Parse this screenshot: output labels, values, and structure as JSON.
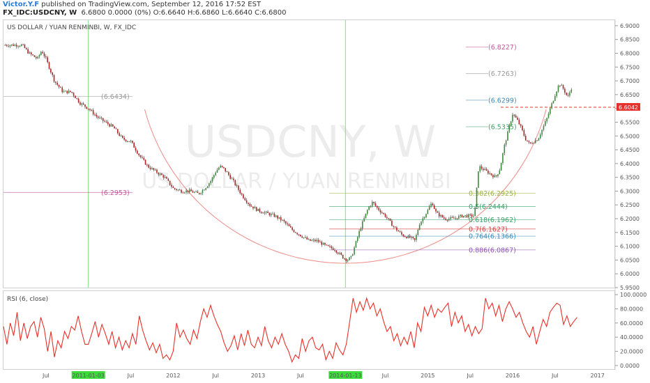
{
  "header": {
    "author": "Victor.Y.F",
    "published": " published on TradingView.com, September 12, 2016 17:52 EST",
    "symbol": "FX_IDC:USDCNY, W",
    "ohlc": "6.6800 0.0000 (0%) O:6.6640 H:6.6860 L:6.6640 C:6.6800"
  },
  "main_panel": {
    "title": "US DOLLAR / YUAN RENMINBI, W, FX_IDC",
    "watermark_symbol": "USDCNY, W",
    "watermark_name": "US DOLLAR / YUAN RENMINBI"
  },
  "rsi_panel": {
    "title": "RSI (6, close)"
  },
  "price_badge": {
    "value": "6.6042",
    "color": "#e8302a"
  },
  "colors": {
    "candle_up": "#3b8a3b",
    "candle_down": "#b22222",
    "rsi": "#e8302a",
    "arc": "#e8302a"
  },
  "chart_data": [
    {
      "type": "candlestick",
      "ylim": [
        5.95,
        6.92
      ],
      "yticks": [
        "6.9000",
        "6.8500",
        "6.8000",
        "6.7500",
        "6.7000",
        "6.6500",
        "6.6000",
        "6.5500",
        "6.5000",
        "6.4500",
        "6.4000",
        "6.3500",
        "6.3000",
        "6.2500",
        "6.2000",
        "6.1500",
        "6.1000",
        "6.0500",
        "6.0000",
        "5.9500"
      ],
      "ytick_values": [
        6.9,
        6.85,
        6.8,
        6.75,
        6.7,
        6.65,
        6.6,
        6.55,
        6.5,
        6.45,
        6.4,
        6.35,
        6.3,
        6.25,
        6.2,
        6.15,
        6.1,
        6.05,
        6.0,
        5.95
      ],
      "xticks": [
        "Jul",
        "2011-01-03",
        "Jul",
        "2012",
        "Jul",
        "2013",
        "Jul",
        "2014-01-13",
        "Jul",
        "2015",
        "Jul",
        "2016",
        "Jul",
        "2017"
      ],
      "xtick_years": [
        2010.5,
        2011.0,
        2011.5,
        2012.0,
        2012.5,
        2013.0,
        2013.5,
        2014.03,
        2014.5,
        2015.0,
        2015.5,
        2016.0,
        2016.5,
        2017.0
      ],
      "highlighted_xticks": [
        "2011-01-03",
        "2014-01-13"
      ],
      "price_path": [
        [
          2010.0,
          6.83
        ],
        [
          2010.15,
          6.83
        ],
        [
          2010.22,
          6.83
        ],
        [
          2010.3,
          6.8
        ],
        [
          2010.4,
          6.78
        ],
        [
          2010.45,
          6.81
        ],
        [
          2010.5,
          6.78
        ],
        [
          2010.6,
          6.7
        ],
        [
          2010.7,
          6.66
        ],
        [
          2010.8,
          6.66
        ],
        [
          2010.9,
          6.62
        ],
        [
          2011.0,
          6.6
        ],
        [
          2011.1,
          6.57
        ],
        [
          2011.2,
          6.55
        ],
        [
          2011.3,
          6.53
        ],
        [
          2011.4,
          6.49
        ],
        [
          2011.5,
          6.48
        ],
        [
          2011.6,
          6.43
        ],
        [
          2011.7,
          6.39
        ],
        [
          2011.8,
          6.37
        ],
        [
          2011.9,
          6.35
        ],
        [
          2012.0,
          6.31
        ],
        [
          2012.1,
          6.3
        ],
        [
          2012.2,
          6.3
        ],
        [
          2012.3,
          6.29
        ],
        [
          2012.4,
          6.32
        ],
        [
          2012.45,
          6.34
        ],
        [
          2012.5,
          6.37
        ],
        [
          2012.55,
          6.39
        ],
        [
          2012.6,
          6.38
        ],
        [
          2012.7,
          6.34
        ],
        [
          2012.8,
          6.29
        ],
        [
          2012.9,
          6.25
        ],
        [
          2013.0,
          6.23
        ],
        [
          2013.1,
          6.22
        ],
        [
          2013.2,
          6.21
        ],
        [
          2013.3,
          6.19
        ],
        [
          2013.4,
          6.16
        ],
        [
          2013.5,
          6.14
        ],
        [
          2013.6,
          6.12
        ],
        [
          2013.7,
          6.12
        ],
        [
          2013.8,
          6.1
        ],
        [
          2013.9,
          6.09
        ],
        [
          2014.0,
          6.06
        ],
        [
          2014.05,
          6.05
        ],
        [
          2014.1,
          6.06
        ],
        [
          2014.2,
          6.16
        ],
        [
          2014.3,
          6.24
        ],
        [
          2014.35,
          6.26
        ],
        [
          2014.4,
          6.24
        ],
        [
          2014.5,
          6.21
        ],
        [
          2014.6,
          6.17
        ],
        [
          2014.7,
          6.14
        ],
        [
          2014.8,
          6.13
        ],
        [
          2014.85,
          6.12
        ],
        [
          2014.9,
          6.18
        ],
        [
          2015.0,
          6.23
        ],
        [
          2015.05,
          6.26
        ],
        [
          2015.1,
          6.22
        ],
        [
          2015.2,
          6.2
        ],
        [
          2015.3,
          6.2
        ],
        [
          2015.4,
          6.21
        ],
        [
          2015.5,
          6.21
        ],
        [
          2015.55,
          6.21
        ],
        [
          2015.6,
          6.39
        ],
        [
          2015.7,
          6.37
        ],
        [
          2015.8,
          6.35
        ],
        [
          2015.85,
          6.38
        ],
        [
          2015.9,
          6.46
        ],
        [
          2016.0,
          6.58
        ],
        [
          2016.05,
          6.56
        ],
        [
          2016.1,
          6.53
        ],
        [
          2016.15,
          6.49
        ],
        [
          2016.2,
          6.47
        ],
        [
          2016.3,
          6.49
        ],
        [
          2016.4,
          6.56
        ],
        [
          2016.5,
          6.65
        ],
        [
          2016.55,
          6.69
        ],
        [
          2016.6,
          6.67
        ],
        [
          2016.65,
          6.64
        ],
        [
          2016.7,
          6.68
        ]
      ],
      "levels": [
        {
          "label": "(6.6434)",
          "value": 6.6434
        },
        {
          "label": "(6.2953)",
          "value": 6.2953
        },
        {
          "label": "(6.8227)",
          "value": 6.8227
        },
        {
          "label": "(6.7263)",
          "value": 6.7263
        },
        {
          "label": "(6.6299)",
          "value": 6.6299
        },
        {
          "label": "(6.5335)",
          "value": 6.5335
        },
        {
          "label": "0.382(6.2925)",
          "value": 6.2925
        },
        {
          "label": "0.5(6.2444)",
          "value": 6.2444
        },
        {
          "label": "0.618(6.1962)",
          "value": 6.1962
        },
        {
          "label": "0.7(6.1627)",
          "value": 6.1627
        },
        {
          "label": "0.764(6.1366)",
          "value": 6.1366
        },
        {
          "label": "0.886(6.0867)",
          "value": 6.0867
        }
      ],
      "last_price": 6.6042
    },
    {
      "type": "line",
      "name": "RSI (6, close)",
      "ylim": [
        -5,
        105
      ],
      "yticks": [
        "100.0000",
        "80.0000",
        "60.0000",
        "40.0000",
        "20.0000",
        "0.0000"
      ],
      "ytick_values": [
        100,
        80,
        60,
        40,
        20,
        0
      ],
      "rsi_path": [
        [
          2010.0,
          55
        ],
        [
          2010.04,
          30
        ],
        [
          2010.08,
          60
        ],
        [
          2010.12,
          42
        ],
        [
          2010.16,
          75
        ],
        [
          2010.2,
          35
        ],
        [
          2010.24,
          60
        ],
        [
          2010.28,
          38
        ],
        [
          2010.32,
          55
        ],
        [
          2010.36,
          62
        ],
        [
          2010.4,
          40
        ],
        [
          2010.44,
          68
        ],
        [
          2010.48,
          52
        ],
        [
          2010.52,
          20
        ],
        [
          2010.56,
          48
        ],
        [
          2010.6,
          12
        ],
        [
          2010.64,
          35
        ],
        [
          2010.68,
          25
        ],
        [
          2010.72,
          48
        ],
        [
          2010.76,
          38
        ],
        [
          2010.8,
          55
        ],
        [
          2010.84,
          50
        ],
        [
          2010.88,
          70
        ],
        [
          2010.92,
          48
        ],
        [
          2010.96,
          30
        ],
        [
          2011.0,
          30
        ],
        [
          2011.04,
          45
        ],
        [
          2011.08,
          62
        ],
        [
          2011.12,
          40
        ],
        [
          2011.16,
          58
        ],
        [
          2011.2,
          45
        ],
        [
          2011.24,
          30
        ],
        [
          2011.28,
          48
        ],
        [
          2011.32,
          25
        ],
        [
          2011.36,
          40
        ],
        [
          2011.4,
          22
        ],
        [
          2011.44,
          35
        ],
        [
          2011.48,
          25
        ],
        [
          2011.52,
          45
        ],
        [
          2011.56,
          30
        ],
        [
          2011.6,
          70
        ],
        [
          2011.64,
          50
        ],
        [
          2011.68,
          35
        ],
        [
          2011.72,
          22
        ],
        [
          2011.76,
          32
        ],
        [
          2011.8,
          18
        ],
        [
          2011.84,
          30
        ],
        [
          2011.88,
          10
        ],
        [
          2011.92,
          15
        ],
        [
          2011.96,
          8
        ],
        [
          2012.0,
          20
        ],
        [
          2012.04,
          60
        ],
        [
          2012.08,
          40
        ],
        [
          2012.12,
          50
        ],
        [
          2012.16,
          38
        ],
        [
          2012.2,
          30
        ],
        [
          2012.24,
          50
        ],
        [
          2012.28,
          38
        ],
        [
          2012.32,
          62
        ],
        [
          2012.36,
          80
        ],
        [
          2012.4,
          68
        ],
        [
          2012.44,
          85
        ],
        [
          2012.48,
          70
        ],
        [
          2012.52,
          58
        ],
        [
          2012.56,
          48
        ],
        [
          2012.6,
          32
        ],
        [
          2012.64,
          20
        ],
        [
          2012.68,
          28
        ],
        [
          2012.72,
          42
        ],
        [
          2012.76,
          22
        ],
        [
          2012.8,
          45
        ],
        [
          2012.84,
          28
        ],
        [
          2012.88,
          50
        ],
        [
          2012.92,
          30
        ],
        [
          2012.96,
          25
        ],
        [
          2013.0,
          40
        ],
        [
          2013.04,
          28
        ],
        [
          2013.08,
          55
        ],
        [
          2013.12,
          35
        ],
        [
          2013.16,
          25
        ],
        [
          2013.2,
          40
        ],
        [
          2013.24,
          30
        ],
        [
          2013.28,
          45
        ],
        [
          2013.32,
          30
        ],
        [
          2013.36,
          20
        ],
        [
          2013.4,
          5
        ],
        [
          2013.44,
          15
        ],
        [
          2013.48,
          10
        ],
        [
          2013.52,
          38
        ],
        [
          2013.56,
          20
        ],
        [
          2013.6,
          35
        ],
        [
          2013.64,
          40
        ],
        [
          2013.68,
          25
        ],
        [
          2013.72,
          22
        ],
        [
          2013.76,
          30
        ],
        [
          2013.8,
          8
        ],
        [
          2013.84,
          20
        ],
        [
          2013.88,
          10
        ],
        [
          2013.92,
          32
        ],
        [
          2013.96,
          22
        ],
        [
          2014.0,
          15
        ],
        [
          2014.04,
          30
        ],
        [
          2014.08,
          62
        ],
        [
          2014.12,
          95
        ],
        [
          2014.16,
          75
        ],
        [
          2014.2,
          90
        ],
        [
          2014.24,
          78
        ],
        [
          2014.28,
          95
        ],
        [
          2014.32,
          80
        ],
        [
          2014.36,
          88
        ],
        [
          2014.4,
          70
        ],
        [
          2014.44,
          80
        ],
        [
          2014.48,
          62
        ],
        [
          2014.52,
          48
        ],
        [
          2014.56,
          55
        ],
        [
          2014.6,
          35
        ],
        [
          2014.64,
          45
        ],
        [
          2014.68,
          28
        ],
        [
          2014.72,
          40
        ],
        [
          2014.76,
          30
        ],
        [
          2014.8,
          48
        ],
        [
          2014.84,
          25
        ],
        [
          2014.88,
          60
        ],
        [
          2014.92,
          48
        ],
        [
          2014.96,
          82
        ],
        [
          2015.0,
          70
        ],
        [
          2015.04,
          85
        ],
        [
          2015.08,
          68
        ],
        [
          2015.12,
          80
        ],
        [
          2015.16,
          75
        ],
        [
          2015.2,
          82
        ],
        [
          2015.24,
          88
        ],
        [
          2015.28,
          55
        ],
        [
          2015.32,
          75
        ],
        [
          2015.36,
          60
        ],
        [
          2015.4,
          70
        ],
        [
          2015.44,
          48
        ],
        [
          2015.48,
          58
        ],
        [
          2015.52,
          42
        ],
        [
          2015.56,
          55
        ],
        [
          2015.6,
          45
        ],
        [
          2015.64,
          52
        ],
        [
          2015.68,
          95
        ],
        [
          2015.72,
          80
        ],
        [
          2015.76,
          88
        ],
        [
          2015.8,
          70
        ],
        [
          2015.84,
          85
        ],
        [
          2015.88,
          62
        ],
        [
          2015.92,
          80
        ],
        [
          2015.96,
          90
        ],
        [
          2016.0,
          80
        ],
        [
          2016.04,
          68
        ],
        [
          2016.08,
          75
        ],
        [
          2016.12,
          60
        ],
        [
          2016.16,
          48
        ],
        [
          2016.2,
          40
        ],
        [
          2016.24,
          55
        ],
        [
          2016.28,
          30
        ],
        [
          2016.32,
          48
        ],
        [
          2016.36,
          65
        ],
        [
          2016.4,
          55
        ],
        [
          2016.44,
          75
        ],
        [
          2016.48,
          82
        ],
        [
          2016.52,
          88
        ],
        [
          2016.56,
          85
        ],
        [
          2016.6,
          58
        ],
        [
          2016.64,
          70
        ],
        [
          2016.68,
          55
        ],
        [
          2016.72,
          62
        ],
        [
          2016.76,
          68
        ]
      ]
    }
  ]
}
